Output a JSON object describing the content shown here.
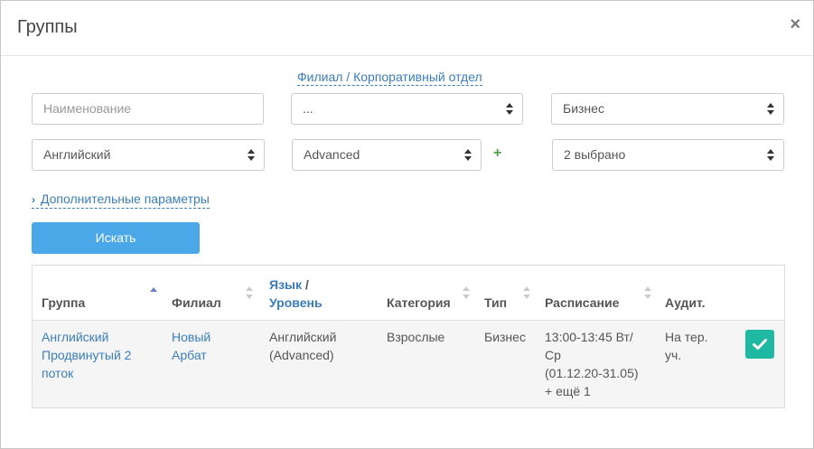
{
  "modal": {
    "title": "Группы",
    "close_label": "×"
  },
  "filters": {
    "branch_link": "Филиал / Корпоративный отдел",
    "name_placeholder": "Наименование",
    "branch_select": "...",
    "type_select": "Бизнес",
    "language_select": "Английский",
    "level_select": "Advanced",
    "add_level": "+",
    "category_select": "2 выбрано",
    "more_params": "Дополнительные параметры",
    "search_button": "Искать"
  },
  "table": {
    "headers": {
      "group": "Группа",
      "branch": "Филиал",
      "language": "Язык",
      "lang_sep": "/",
      "level": "Уровень",
      "category": "Категория",
      "type": "Тип",
      "schedule": "Расписание",
      "room": "Аудит."
    },
    "rows": [
      {
        "group_l1": "Английский",
        "group_l2": "Продвинутый 2",
        "group_l3": "поток",
        "branch_l1": "Новый",
        "branch_l2": "Арбат",
        "language_l1": "Английский",
        "language_l2": "(Advanced)",
        "category": "Взрослые",
        "type": "Бизнес",
        "schedule_l1": "13:00-13:45 Вт/",
        "schedule_l2": "Ср",
        "schedule_l3": "(01.12.20-31.05)",
        "schedule_l4": "+ ещё 1",
        "room_l1": "На тер.",
        "room_l2": "уч."
      }
    ]
  },
  "colors": {
    "link": "#3a7dbf",
    "primary_button": "#4aa8e8",
    "select_button": "#1fb8a3",
    "plus": "#4fa04f"
  }
}
